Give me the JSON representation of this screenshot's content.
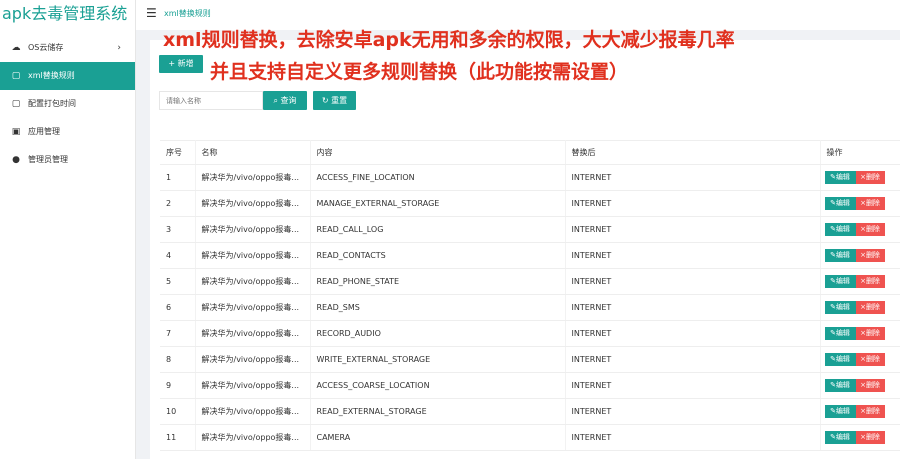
{
  "app": {
    "title": "apk去毒管理系统"
  },
  "topbar": {
    "menu_icon": "menu-icon",
    "title": "xml替换规则"
  },
  "sidebar": {
    "items": [
      {
        "label": "OS云储存",
        "icon": "cloud-icon",
        "has_submenu": true,
        "active": false
      },
      {
        "label": "xml替换规则",
        "icon": "clipboard-icon",
        "has_submenu": false,
        "active": true
      },
      {
        "label": "配置打包时间",
        "icon": "clipboard-icon",
        "has_submenu": false,
        "active": false
      },
      {
        "label": "应用管理",
        "icon": "android-icon",
        "has_submenu": false,
        "active": false
      },
      {
        "label": "管理员管理",
        "icon": "user-icon",
        "has_submenu": false,
        "active": false
      }
    ]
  },
  "toolbar": {
    "add_label": "+ 新增",
    "search_placeholder": "请输入名称",
    "search_label": "查询",
    "reset_label": "重置"
  },
  "overlay": {
    "line1": "xml规则替换，去除安卓apk无用和多余的权限，大大减少报毒几率",
    "line2": "并且支持自定义更多规则替换（此功能按需设置）",
    "color": "#e0301e"
  },
  "table": {
    "headers": [
      "序号",
      "名称",
      "内容",
      "替换后",
      "操作"
    ],
    "edit_label": "编辑",
    "delete_label": "删除",
    "rows": [
      {
        "no": "1",
        "name": "解决华为/vivo/oppo报毒...",
        "content": "ACCESS_FINE_LOCATION",
        "replace": "INTERNET"
      },
      {
        "no": "2",
        "name": "解决华为/vivo/oppo报毒...",
        "content": "MANAGE_EXTERNAL_STORAGE",
        "replace": "INTERNET"
      },
      {
        "no": "3",
        "name": "解决华为/vivo/oppo报毒...",
        "content": "READ_CALL_LOG",
        "replace": "INTERNET"
      },
      {
        "no": "4",
        "name": "解决华为/vivo/oppo报毒...",
        "content": "READ_CONTACTS",
        "replace": "INTERNET"
      },
      {
        "no": "5",
        "name": "解决华为/vivo/oppo报毒...",
        "content": "READ_PHONE_STATE",
        "replace": "INTERNET"
      },
      {
        "no": "6",
        "name": "解决华为/vivo/oppo报毒...",
        "content": "READ_SMS",
        "replace": "INTERNET"
      },
      {
        "no": "7",
        "name": "解决华为/vivo/oppo报毒...",
        "content": "RECORD_AUDIO",
        "replace": "INTERNET"
      },
      {
        "no": "8",
        "name": "解决华为/vivo/oppo报毒...",
        "content": "WRITE_EXTERNAL_STORAGE",
        "replace": "INTERNET"
      },
      {
        "no": "9",
        "name": "解决华为/vivo/oppo报毒...",
        "content": "ACCESS_COARSE_LOCATION",
        "replace": "INTERNET"
      },
      {
        "no": "10",
        "name": "解决华为/vivo/oppo报毒...",
        "content": "READ_EXTERNAL_STORAGE",
        "replace": "INTERNET"
      },
      {
        "no": "11",
        "name": "解决华为/vivo/oppo报毒...",
        "content": "CAMERA",
        "replace": "INTERNET"
      }
    ]
  },
  "colors": {
    "accent": "#1aa094",
    "danger": "#ef5350"
  }
}
